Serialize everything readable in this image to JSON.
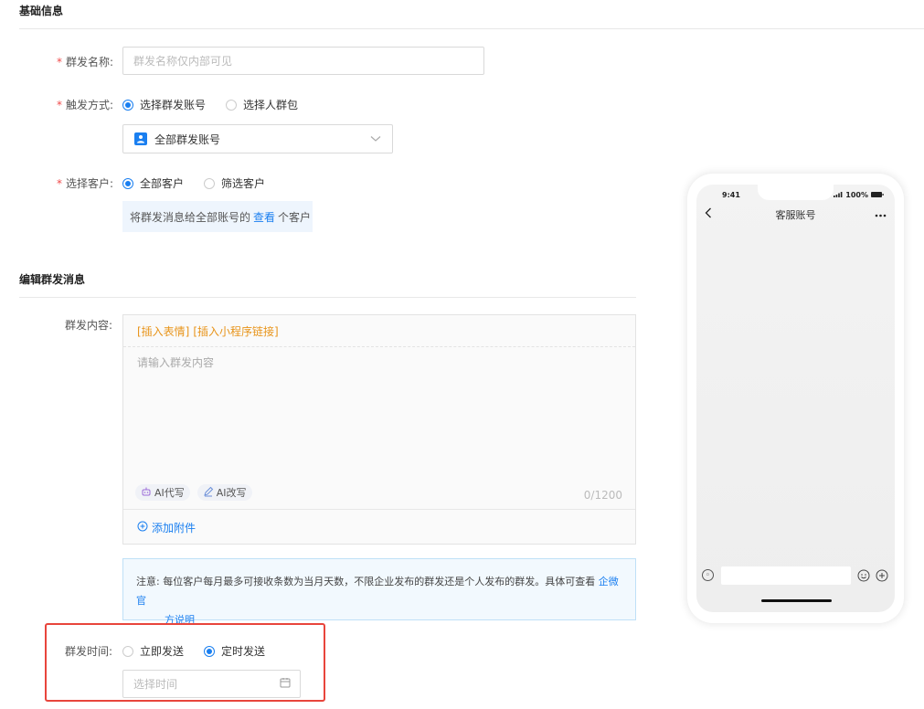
{
  "basic": {
    "title": "基础信息",
    "name_label": "群发名称:",
    "name_placeholder": "群发名称仅内部可见",
    "trigger_label": "触发方式:",
    "trigger_options": [
      "选择群发账号",
      "选择人群包"
    ],
    "account_select": "全部群发账号",
    "customer_label": "选择客户:",
    "customer_options": [
      "全部客户",
      "筛选客户"
    ],
    "info_prefix": "将群发消息给全部账号的",
    "info_link": "查看",
    "info_suffix": "个客户"
  },
  "edit": {
    "title": "编辑群发消息",
    "content_label": "群发内容:",
    "insert_emoji": "[插入表情]",
    "insert_mini": "[插入小程序链接]",
    "content_placeholder": "请输入群发内容",
    "ai_write": "AI代写",
    "ai_rewrite": "AI改写",
    "counter": "0/1200",
    "add_attachment": "添加附件",
    "notice_text": "注意:  每位客户每月最多可接收条数为当月天数，不限企业发布的群发还是个人发布的群发。具体可查看",
    "notice_link_1": "企微官",
    "notice_link_2": "方说明",
    "time_label": "群发时间:",
    "time_options": [
      "立即发送",
      "定时发送"
    ],
    "time_placeholder": "选择时间"
  },
  "phone": {
    "time": "9:41",
    "battery": "100%",
    "title": "客服账号"
  },
  "colors": {
    "accent": "#1a7ff0",
    "required": "#f04b4b",
    "insert_link": "#e8941a",
    "highlight_border": "#e8453c"
  }
}
